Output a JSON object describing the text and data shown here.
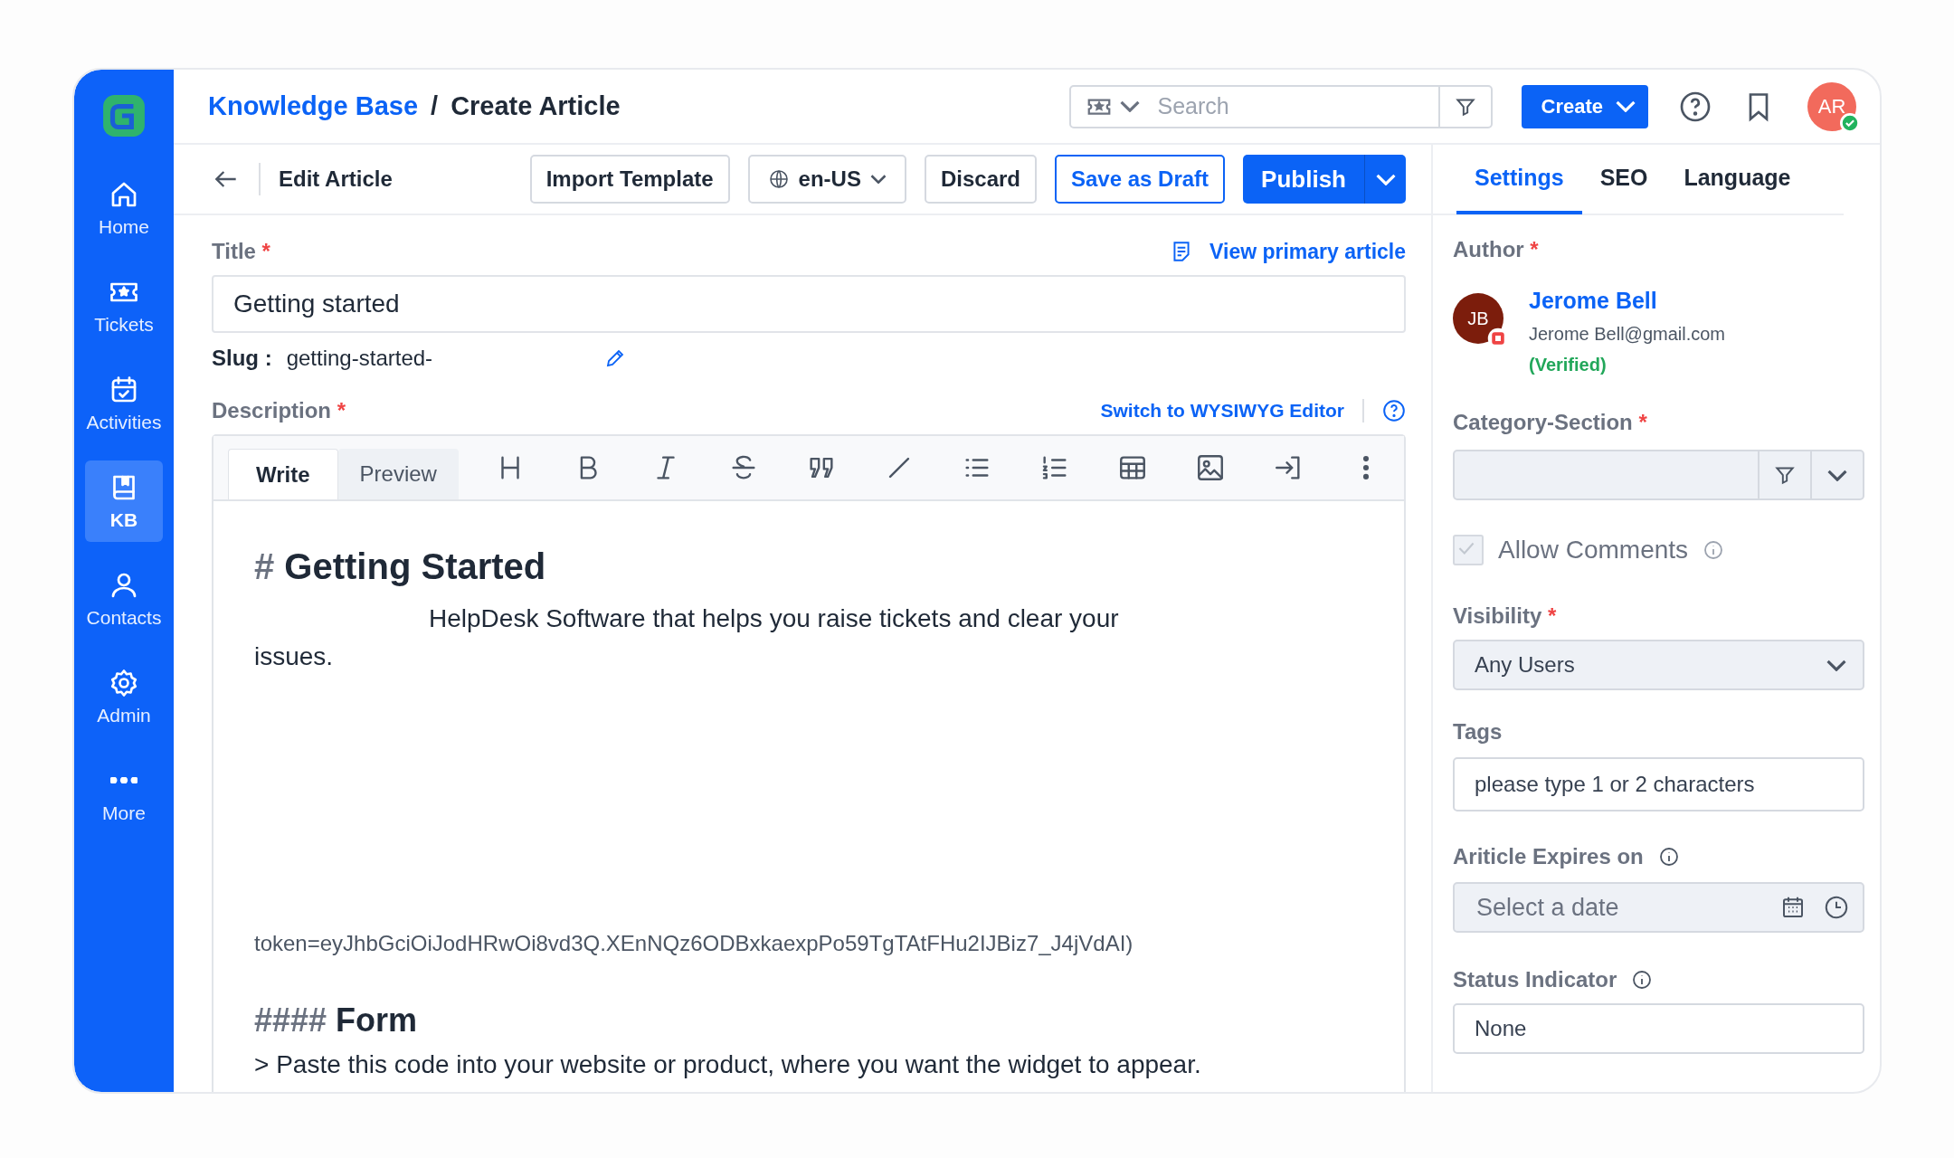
{
  "sidebar": {
    "items": [
      {
        "label": "Home",
        "selected": false
      },
      {
        "label": "Tickets",
        "selected": false
      },
      {
        "label": "Activities",
        "selected": false
      },
      {
        "label": "KB",
        "selected": true
      },
      {
        "label": "Contacts",
        "selected": false
      },
      {
        "label": "Admin",
        "selected": false
      },
      {
        "label": "More",
        "selected": false
      }
    ]
  },
  "header": {
    "breadcrumb": {
      "parent": "Knowledge Base",
      "separator": "/",
      "current": "Create Article"
    },
    "search": {
      "placeholder": "Search"
    },
    "create_button": "Create",
    "user": {
      "initials": "AR",
      "online": true
    }
  },
  "toolbar": {
    "title": "Edit Article",
    "import_button": "Import Template",
    "language": "en-US",
    "discard_button": "Discard",
    "draft_button": "Save as Draft",
    "publish_button": "Publish"
  },
  "panel_tabs": [
    {
      "label": "Settings",
      "selected": true
    },
    {
      "label": "SEO",
      "selected": false
    },
    {
      "label": "Language",
      "selected": false
    }
  ],
  "form": {
    "title": {
      "label": "Title",
      "required_mark": "*",
      "value": "Getting started",
      "link": "View primary article"
    },
    "slug": {
      "label": "Slug :",
      "value": "getting-started-"
    },
    "description": {
      "label": "Description",
      "required_mark": "*",
      "switch_link": "Switch to WYSIWYG Editor",
      "tabs": [
        {
          "label": "Write",
          "selected": true
        },
        {
          "label": "Preview",
          "selected": false
        }
      ],
      "content": [
        {
          "kind": "heading",
          "marker": "#",
          "text": "Getting Started"
        },
        {
          "kind": "paragraph",
          "text": "HelpDesk Software that helps you raise tickets and clear your issues."
        },
        {
          "kind": "code",
          "text": "token=eyJhbGciOiJodHRwOi8vd3Q.XEnNQz6ODBxkaexpPo59TgTAtFHu2IJBiz7_J4jVdAI)"
        },
        {
          "kind": "subheading",
          "marker": "####",
          "text": "Form"
        },
        {
          "kind": "quote",
          "text": "> Paste this code into your website or product, where you want the widget to appear."
        }
      ]
    }
  },
  "settings": {
    "author": {
      "label": "Author",
      "required_mark": "*",
      "initials": "JB",
      "name": "Jerome Bell",
      "email": "Jerome Bell@gmail.com",
      "status": "(Verified)"
    },
    "category_section": {
      "label": "Category-Section",
      "required_mark": "*"
    },
    "allow_comments": {
      "label": "Allow Comments",
      "checked": true
    },
    "visibility": {
      "label": "Visibility",
      "required_mark": "*",
      "value": "Any Users"
    },
    "tags": {
      "label": "Tags",
      "placeholder": "please type 1 or 2 characters"
    },
    "expires": {
      "label": "Ariticle Expires on",
      "placeholder": "Select a date"
    },
    "status_indicator": {
      "label": "Status Indicator",
      "value": "None"
    }
  }
}
